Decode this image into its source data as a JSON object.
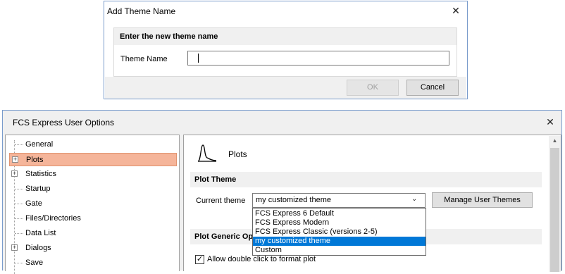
{
  "add_theme_dialog": {
    "title": "Add Theme Name",
    "close_glyph": "✕",
    "group_header": "Enter the new theme name",
    "theme_name_label": "Theme Name",
    "theme_name_value": "",
    "ok_label": "OK",
    "cancel_label": "Cancel"
  },
  "options_window": {
    "title": "FCS Express User Options",
    "close_glyph": "✕",
    "tree": {
      "items": [
        {
          "label": "General",
          "expandable": false,
          "selected": false
        },
        {
          "label": "Plots",
          "expandable": true,
          "selected": true
        },
        {
          "label": "Statistics",
          "expandable": true,
          "selected": false
        },
        {
          "label": "Startup",
          "expandable": false,
          "selected": false
        },
        {
          "label": "Gate",
          "expandable": false,
          "selected": false
        },
        {
          "label": "Files/Directories",
          "expandable": false,
          "selected": false
        },
        {
          "label": "Data List",
          "expandable": false,
          "selected": false
        },
        {
          "label": "Dialogs",
          "expandable": true,
          "selected": false
        },
        {
          "label": "Save",
          "expandable": false,
          "selected": false
        }
      ],
      "expander_glyph": "+"
    },
    "panel": {
      "heading": "Plots",
      "icon": "plot-curve-icon",
      "plot_theme_header": "Plot Theme",
      "current_theme_label": "Current theme",
      "current_theme_value": "my customized theme",
      "dropdown_arrow": "⌄",
      "manage_button_label": "Manage User Themes",
      "plot_generic_header": "Plot Generic Opti",
      "allow_double_click_label": "Allow double click to format plot",
      "allow_double_click_checked": true,
      "check_glyph": "✓",
      "theme_options": [
        {
          "label": "FCS Express 6 Default",
          "selected": false
        },
        {
          "label": "FCS Express Modern",
          "selected": false
        },
        {
          "label": "FCS Express Classic (versions 2-5)",
          "selected": false
        },
        {
          "label": "my customized theme",
          "selected": true
        },
        {
          "label": "Custom",
          "selected": false
        }
      ]
    }
  },
  "colors": {
    "selection": "#f5b59a",
    "highlight": "#0078d7",
    "window_border": "#7a9ccc"
  }
}
